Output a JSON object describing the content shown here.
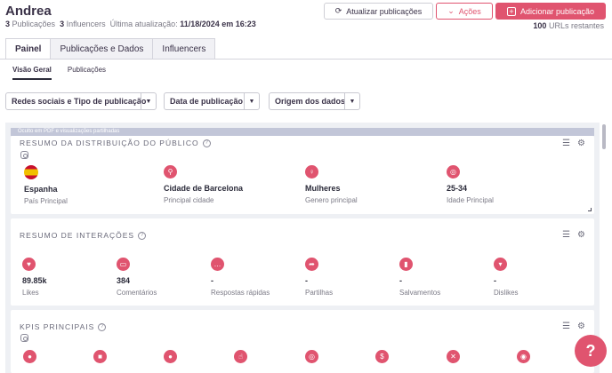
{
  "header": {
    "title": "Andrea",
    "pub_count": "3",
    "pub_label": "Publicações",
    "inf_count": "3",
    "inf_label": "Influencers",
    "update_label": "Última atualização:",
    "update_value": "11/18/2024 em 16:23",
    "btn_update": "Atualizar publicações",
    "btn_actions": "Ações",
    "btn_add": "Adicionar publicação",
    "urls_count": "100",
    "urls_label": "URLs restantes"
  },
  "tabs": [
    "Painel",
    "Publicações e Dados",
    "Influencers"
  ],
  "subtabs": [
    "Visão Geral",
    "Publicações"
  ],
  "filters": [
    "Redes sociais e Tipo de publicação",
    "Data de publicação",
    "Origem dos dados"
  ],
  "banner": "Oculto em PDF e visualizações partilhadas",
  "audience": {
    "title": "RESUMO DA DISTRIBUIÇÃO DO PÚBLICO",
    "items": [
      {
        "value": "Espanha",
        "label": "País Principal",
        "icon": "spain-flag-icon"
      },
      {
        "value": "Cidade de Barcelona",
        "label": "Principal cidade",
        "icon": "location-pin-icon"
      },
      {
        "value": "Mulheres",
        "label": "Genero principal",
        "icon": "gender-icon"
      },
      {
        "value": "25-34",
        "label": "Idade Principal",
        "icon": "target-icon"
      }
    ]
  },
  "interactions": {
    "title": "RESUMO DE INTERAÇÕES",
    "items": [
      {
        "value": "89.85k",
        "label": "Likes",
        "icon": "heart-icon"
      },
      {
        "value": "384",
        "label": "Comentários",
        "icon": "comment-icon"
      },
      {
        "value": "-",
        "label": "Respostas rápidas",
        "icon": "quick-reply-icon"
      },
      {
        "value": "-",
        "label": "Partilhas",
        "icon": "share-icon"
      },
      {
        "value": "-",
        "label": "Salvamentos",
        "icon": "bookmark-icon"
      },
      {
        "value": "-",
        "label": "Dislikes",
        "icon": "thumbs-down-icon"
      }
    ]
  },
  "kpis": {
    "title": "KPIS PRINCIPAIS"
  },
  "colors": {
    "accent": "#e0546f",
    "banner": "#c2c6d8",
    "background": "#eef0f4"
  }
}
